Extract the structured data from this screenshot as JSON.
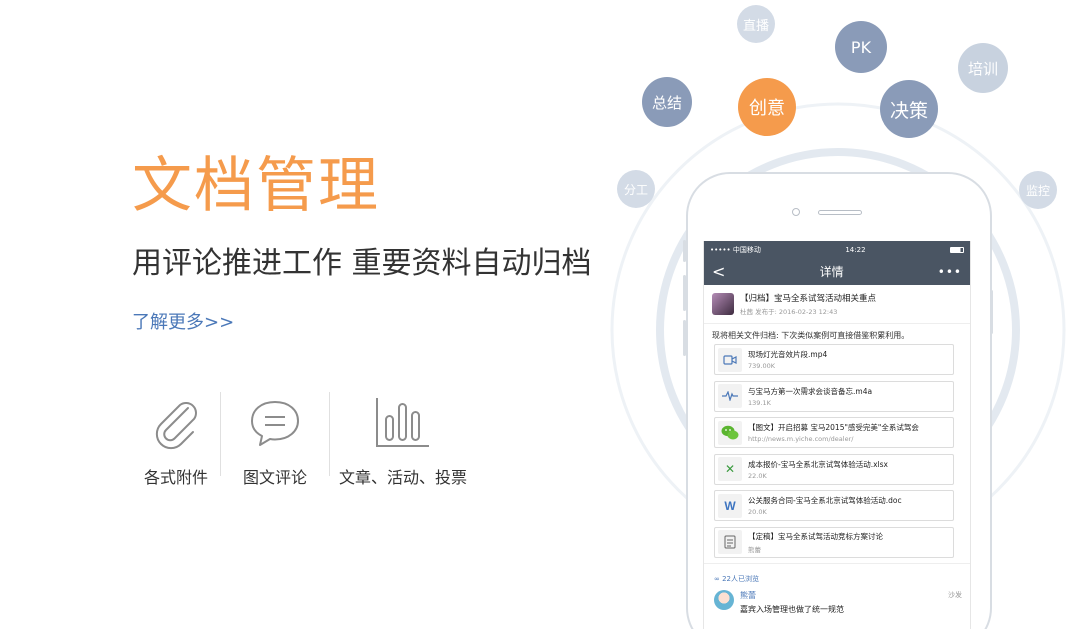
{
  "hero": {
    "title": "文档管理",
    "subtitle": "用评论推进工作 重要资料自动归档",
    "learn_more": "了解更多>>"
  },
  "features": [
    {
      "label": "各式附件",
      "icon": "paperclip-icon"
    },
    {
      "label": "图文评论",
      "icon": "chat-bubble-icon"
    },
    {
      "label": "文章、活动、投票",
      "icon": "bar-chart-icon"
    }
  ],
  "bubbles": {
    "zhibo": "直播",
    "pk": "PK",
    "peixun": "培训",
    "zongjie": "总结",
    "chuangyi": "创意",
    "juece": "决策",
    "fengong": "分工",
    "jiankong": "监控"
  },
  "colors": {
    "accent_orange": "#f59b4c",
    "bubble_dark": "#8a9bb8",
    "bubble_light": "#c8d2df",
    "link_blue": "#4b78b8",
    "navbar": "#4a5563"
  },
  "phone": {
    "status": {
      "carrier": "••••• 中国移动",
      "time": "14:22"
    },
    "nav": {
      "back": "<",
      "title": "详情",
      "more": "•••"
    },
    "post": {
      "title": "【归档】宝马全系试驾活动相关重点",
      "meta": "杜茜 发布于: 2016-02-23 12:43",
      "body": "现将相关文件归档: 下次类似案例可直接借鉴积累利用。"
    },
    "files": [
      {
        "name": "现场灯光音效片段.mp4",
        "sub": "739.00K",
        "icon": "video-icon"
      },
      {
        "name": "与宝马方第一次需求会谈音备忘.m4a",
        "sub": "139.1K",
        "icon": "audio-wave-icon"
      },
      {
        "name": "【图文】开启招募 宝马2015\"感受完美\"全系试驾会",
        "sub": "http://news.m.yiche.com/dealer/",
        "icon": "wechat-icon"
      },
      {
        "name": "成本报价-宝马全系北京试驾体验活动.xlsx",
        "sub": "22.0K",
        "icon": "excel-icon"
      },
      {
        "name": "公关服务合同-宝马全系北京试驾体验活动.doc",
        "sub": "20.0K",
        "icon": "word-icon"
      },
      {
        "name": "【定稿】宝马全系试驾活动竞标方案讨论",
        "sub": "熊蕾",
        "icon": "document-icon"
      }
    ],
    "viewers": "22人已浏览",
    "comment": {
      "name": "熊蕾",
      "time": "沙发",
      "text": "嘉宾入场管理也做了统一规范"
    }
  }
}
